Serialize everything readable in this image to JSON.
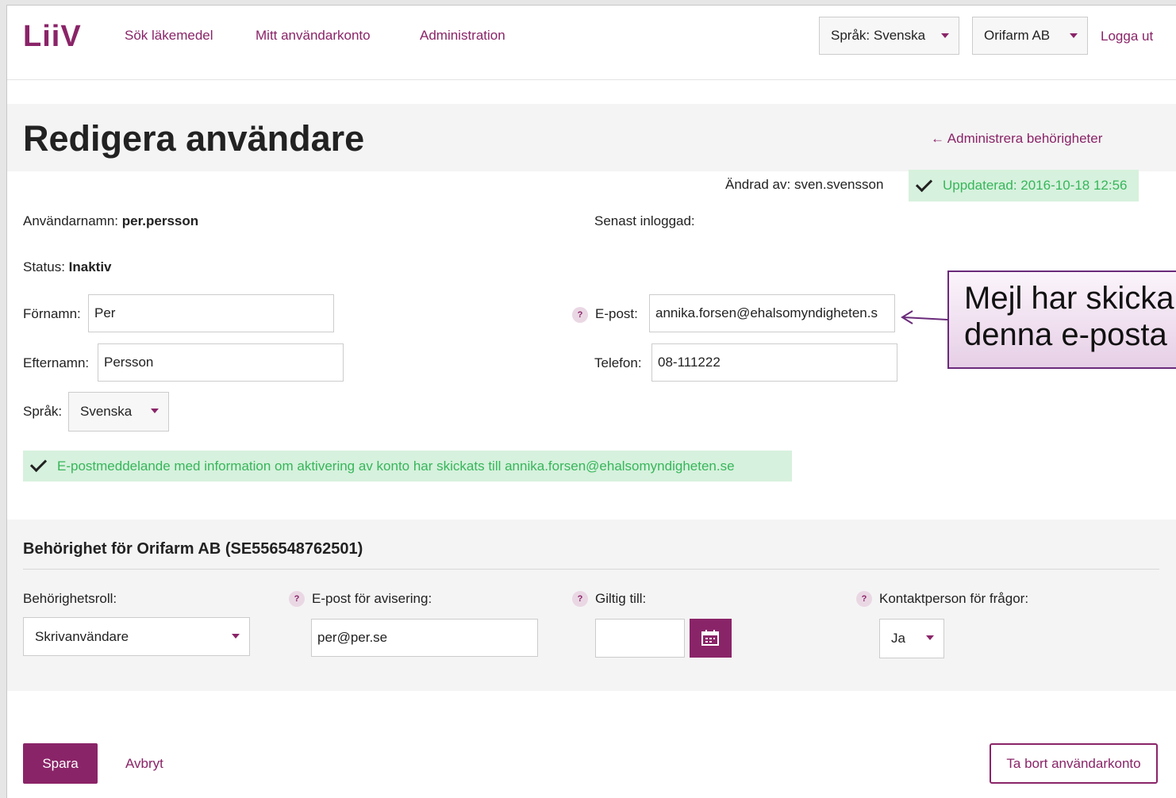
{
  "header": {
    "logo": "LiiV",
    "nav": [
      "Sök läkemedel",
      "Mitt användarkonto",
      "Administration"
    ],
    "language_dropdown": "Språk: Svenska",
    "org_dropdown": "Orifarm AB",
    "logout": "Logga ut"
  },
  "page": {
    "title": "Redigera användare",
    "back_link": "← Administrera behörigheter",
    "changed_by": "Ändrad av: sven.svensson",
    "updated": "Uppdaterad: 2016-10-18 12:56"
  },
  "user": {
    "username_label": "Användarnamn:",
    "username": "per.persson",
    "last_login_label": "Senast inloggad:",
    "status_label": "Status:",
    "status": "Inaktiv",
    "firstname_label": "Förnamn:",
    "firstname": "Per",
    "lastname_label": "Efternamn:",
    "lastname": "Persson",
    "language_label": "Språk:",
    "language": "Svenska",
    "email_label": "E-post:",
    "email": "annika.forsen@ehalsomyndigheten.s",
    "phone_label": "Telefon:",
    "phone": "08-111222",
    "help_glyph": "?"
  },
  "success_message": "E-postmeddelande med information om aktivering av konto har skickats till annika.forsen@ehalsomyndigheten.se",
  "permissions": {
    "title": "Behörighet för Orifarm AB (SE556548762501)",
    "role_label": "Behörighetsroll:",
    "role": "Skrivanvändare",
    "notify_email_label": "E-post för avisering:",
    "notify_email": "per@per.se",
    "valid_until_label": "Giltig till:",
    "valid_until": "",
    "contact_label": "Kontaktperson för frågor:",
    "contact": "Ja"
  },
  "footer": {
    "save": "Spara",
    "cancel": "Avbryt",
    "delete": "Ta bort användarkonto"
  },
  "callout": {
    "line1": "Mejl har skicka",
    "line2": "denna e-posta"
  },
  "colors": {
    "brand": "#8a2468",
    "success_bg": "#d6f1dd",
    "success_text": "#37b65a"
  }
}
